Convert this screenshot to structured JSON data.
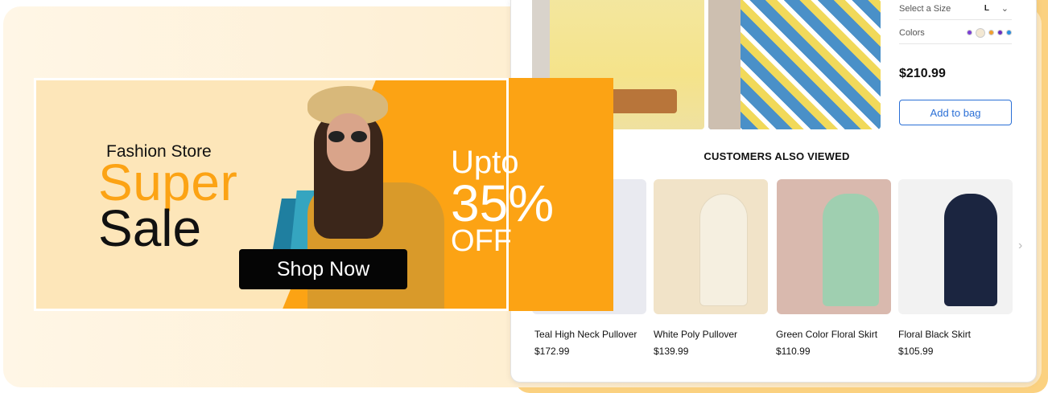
{
  "product": {
    "size_label": "Select a Size",
    "size_value": "L",
    "colors_label": "Colors",
    "color_swatches": [
      "#7b3fd6",
      "#f3e8d3",
      "#f0a030",
      "#6b2fbf",
      "#2a8fe0"
    ],
    "price": "$210.99",
    "add_button": "Add to bag"
  },
  "also_viewed": {
    "title": "CUSTOMERS ALSO VIEWED",
    "items": [
      {
        "name": "Teal High Neck Pullover",
        "price": "$172.99"
      },
      {
        "name": "White Poly Pullover",
        "price": "$139.99"
      },
      {
        "name": "Green Color Floral Skirt",
        "price": "$110.99"
      },
      {
        "name": "Floral Black Skirt",
        "price": "$105.99"
      }
    ]
  },
  "banner": {
    "store": "Fashion Store",
    "headline_1": "Super",
    "headline_2": "Sale",
    "cta": "Shop Now",
    "offer_1": "Upto",
    "offer_2": "35%",
    "offer_3": "OFF"
  },
  "colors": {
    "accent": "#fca314",
    "link": "#2a6fd6"
  }
}
